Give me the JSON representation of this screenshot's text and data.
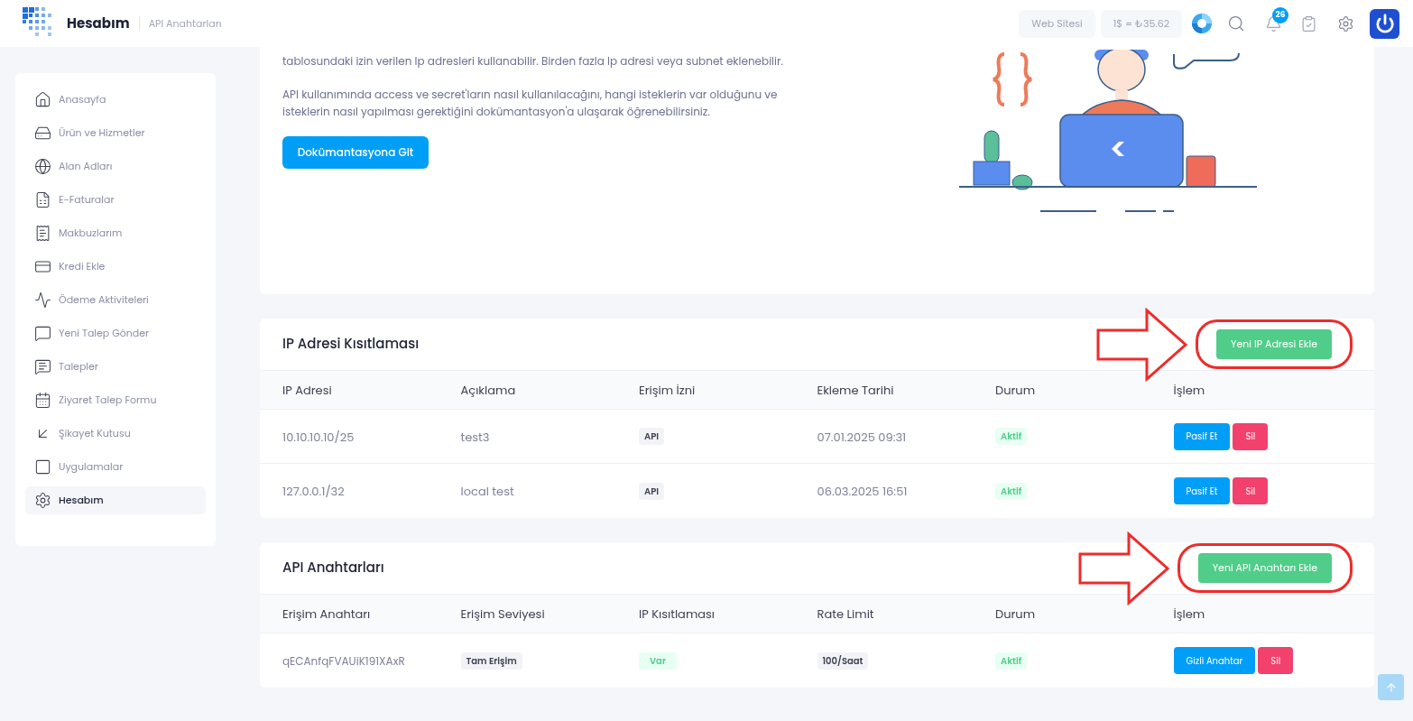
{
  "header": {
    "brand": "Hesabım",
    "breadcrumb": "API Anahtarları",
    "website_button": "Web Sitesi",
    "exchange_rate": "1$ = ₺35.62",
    "notification_count": "26"
  },
  "sidebar": {
    "items": [
      {
        "label": "Anasayfa",
        "selected": false
      },
      {
        "label": "Ürün ve Hizmetler",
        "selected": false
      },
      {
        "label": "Alan Adları",
        "selected": false
      },
      {
        "label": "E-Faturalar",
        "selected": false
      },
      {
        "label": "Makbuzlarım",
        "selected": false
      },
      {
        "label": "Kredi Ekle",
        "selected": false
      },
      {
        "label": "Ödeme Aktiviteleri",
        "selected": false
      },
      {
        "label": "Yeni Talep Gönder",
        "selected": false
      },
      {
        "label": "Talepler",
        "selected": false
      },
      {
        "label": "Ziyaret Talep Formu",
        "selected": false
      },
      {
        "label": "Şikayet Kutusu",
        "selected": false
      },
      {
        "label": "Uygulamalar",
        "selected": false
      },
      {
        "label": "Hesabım",
        "selected": true
      }
    ]
  },
  "intro": {
    "paragraphs": [
      "tablosundaki izin verilen Ip adresleri kullanabilir. Birden fazla Ip adresi veya subnet eklenebilir.",
      "API kullanımında access ve secret'ların nasıl kullanılacağını, hangi isteklerin var olduğunu ve isteklerin nasıl yapılması gerektiğini dokümantasyon'a ulaşarak öğrenebilirsiniz."
    ],
    "button": "Dokümantasyona Git"
  },
  "ip_restriction": {
    "title": "IP Adresi Kısıtlaması",
    "add_button": "Yeni IP Adresi Ekle",
    "columns": [
      "IP Adresi",
      "Açıklama",
      "Erişim İzni",
      "Ekleme Tarihi",
      "Durum",
      "İşlem"
    ],
    "rows": [
      {
        "ip": "10.10.10.10/25",
        "description": "test3",
        "access": "API",
        "date": "07.01.2025 09:31",
        "status": "Aktif",
        "actions": [
          "Pasif Et",
          "Sil"
        ]
      },
      {
        "ip": "127.0.0.1/32",
        "description": "local test",
        "access": "API",
        "date": "06.03.2025 16:51",
        "status": "Aktif",
        "actions": [
          "Pasif Et",
          "Sil"
        ]
      }
    ]
  },
  "api_keys": {
    "title": "API Anahtarları",
    "add_button": "Yeni API Anahtarı Ekle",
    "columns": [
      "Erişim Anahtarı",
      "Erişim Seviyesi",
      "IP Kısıtlaması",
      "Rate Limit",
      "Durum",
      "İşlem"
    ],
    "rows": [
      {
        "key": "qECAnfqFVAUiK191XAxR",
        "level": "Tam Erişim",
        "ip_restriction": "Var",
        "rate_limit": "100/Saat",
        "status": "Aktif",
        "actions": [
          "Gizli Anahtar",
          "Sil"
        ]
      }
    ]
  }
}
